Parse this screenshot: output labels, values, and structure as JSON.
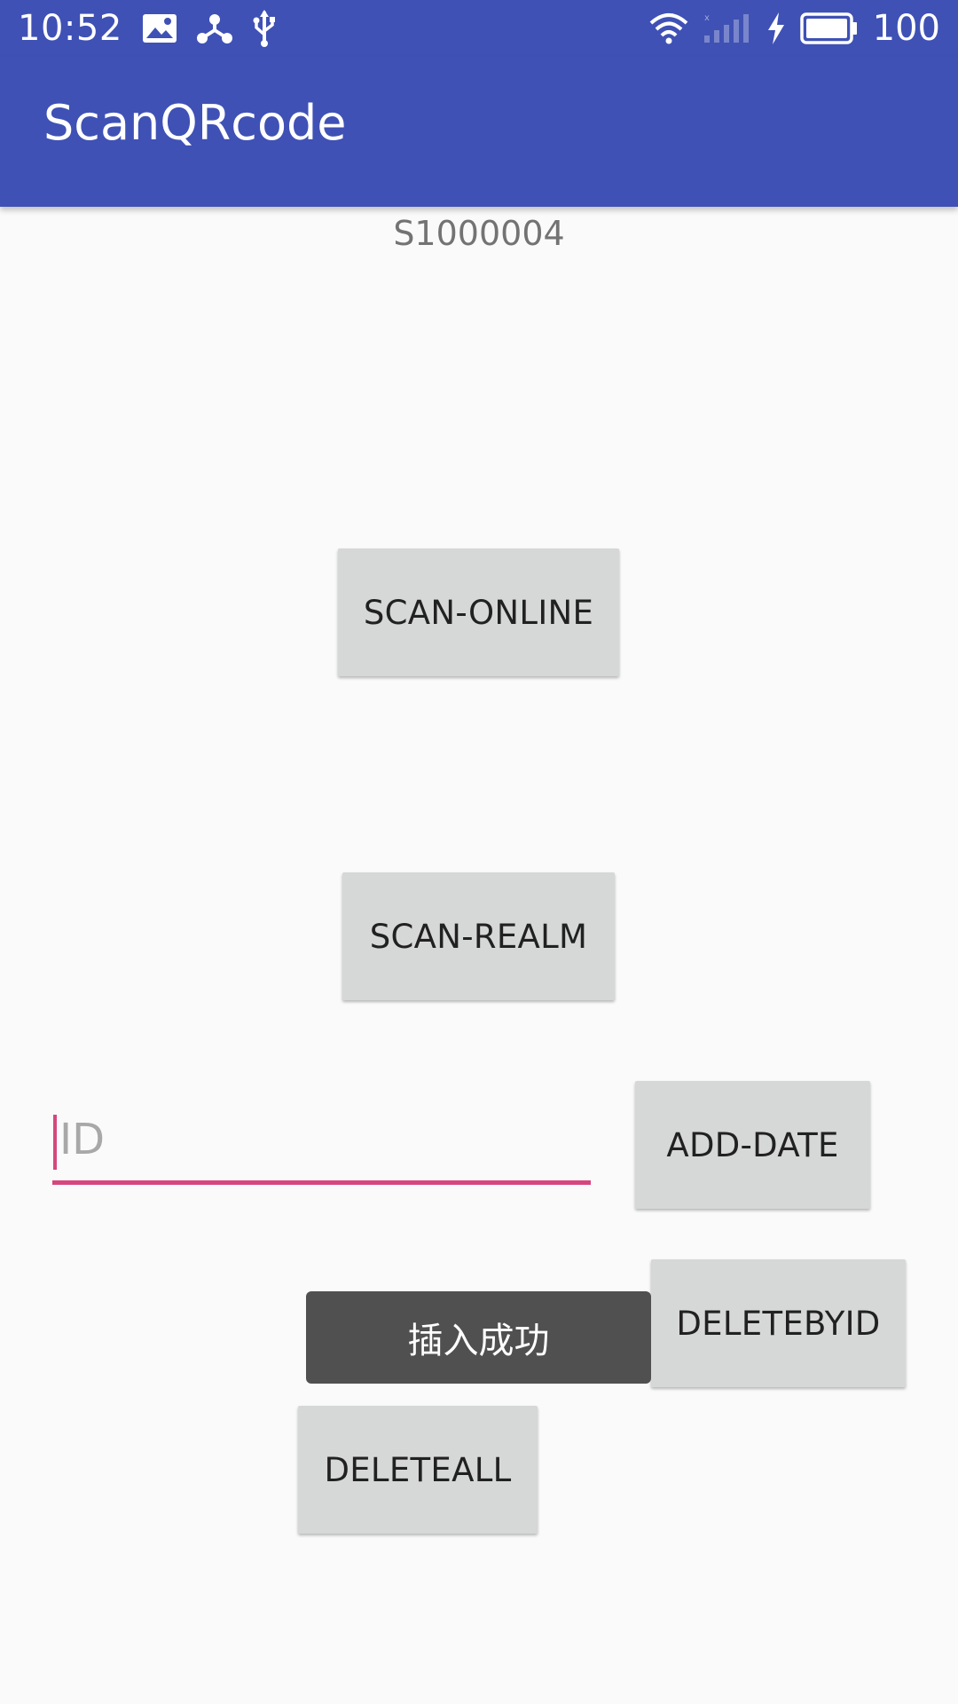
{
  "status_bar": {
    "time": "10:52",
    "battery": "100",
    "icons": [
      "image-icon",
      "share-icon",
      "usb-icon",
      "wifi-icon",
      "signal-icon",
      "charging-icon",
      "battery-icon"
    ]
  },
  "app_bar": {
    "title": "ScanQRcode"
  },
  "main": {
    "code_text": "S1000004",
    "scan_online_label": "SCAN-ONLINE",
    "scan_realm_label": "SCAN-REALM",
    "id_placeholder": "ID",
    "add_date_label": "ADD-DATE",
    "delete_by_id_label": "DELETEBYID",
    "delete_all_label": "DELETEALL"
  },
  "toast": {
    "message": "插入成功"
  },
  "colors": {
    "primary": "#3f51b5",
    "accent": "#d6477e",
    "button": "#d6d7d7",
    "background": "#fafafa",
    "toast": "#505050"
  }
}
